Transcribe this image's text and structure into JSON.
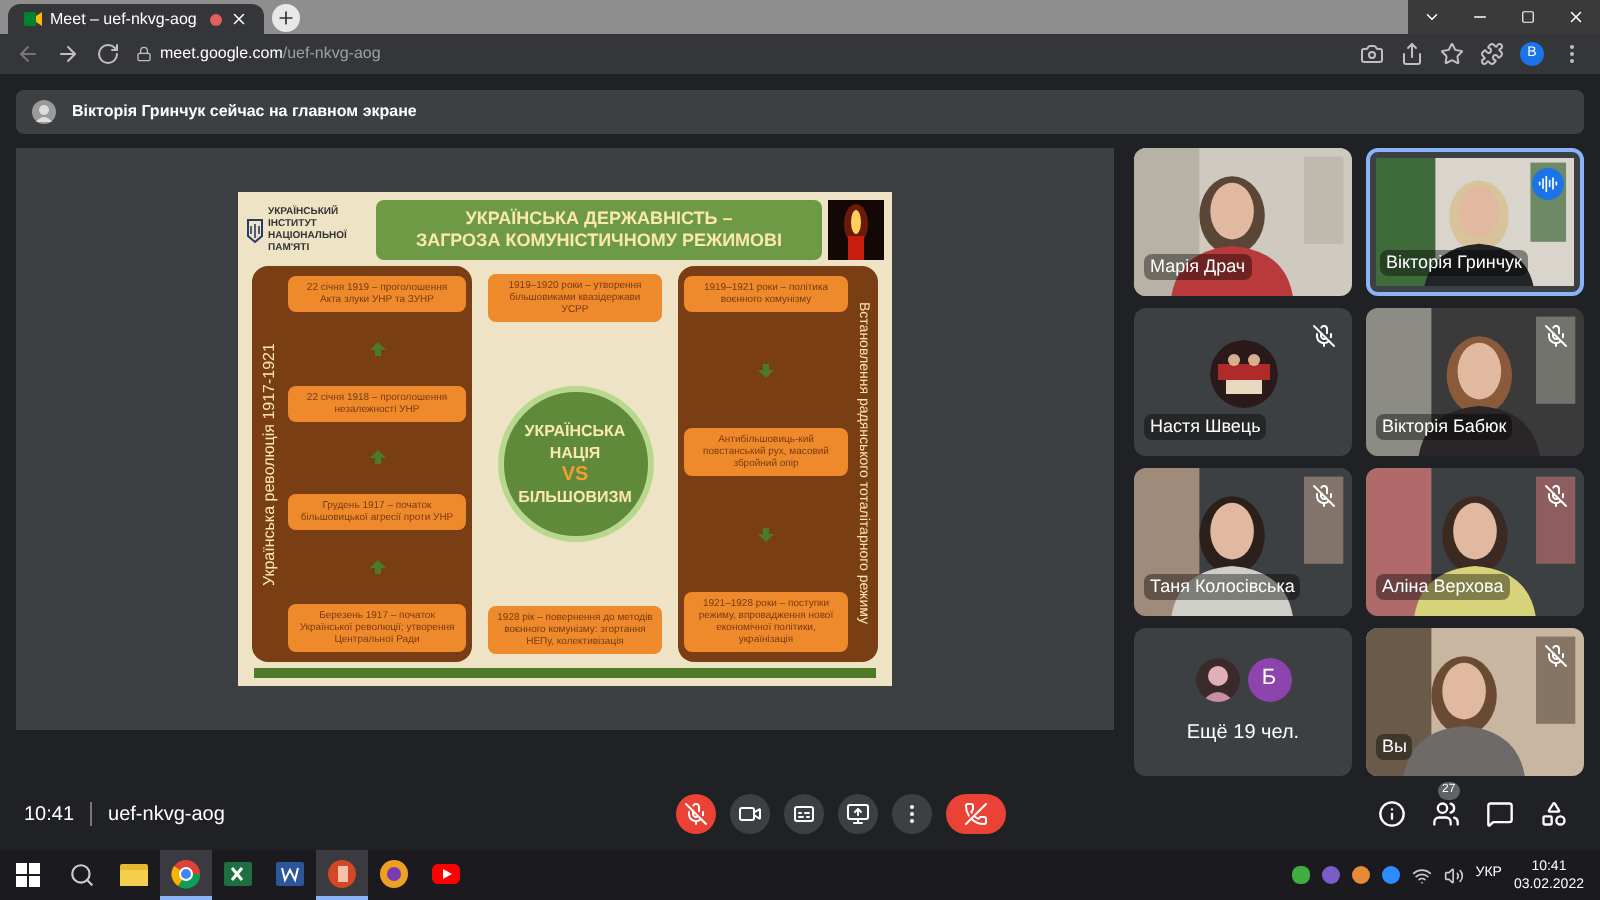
{
  "browser": {
    "tab_title": "Meet – uef-nkvg-aog",
    "url_host": "meet.google.com",
    "url_path": "/uef-nkvg-aog",
    "profile_letter": "В"
  },
  "banner": {
    "text": "Вікторія Гринчук сейчас на главном экране"
  },
  "slide": {
    "institute": "УКРАЇНСЬКИЙ ІНСТИТУТ НАЦІОНАЛЬНОЇ ПАМ'ЯТІ",
    "title_lines": [
      "УКРАЇНСЬКА ДЕРЖАВНІСТЬ –",
      "ЗАГРОЗА КОМУНІСТИЧНОМУ РЕЖИМОВІ"
    ],
    "left_label": "Українська революція 1917-1921",
    "left_boxes": [
      "22 січня 1919 – проголошення Акта злуки УНР та ЗУНР",
      "22 січня 1918 – проголошення незалежності УНР",
      "Грудень 1917 – початок більшовицької агресії проти УНР",
      "Березень 1917 – початок Української революції; утворення Центральної Ради"
    ],
    "top_box": "1919–1920 роки – утворення більшовиками квазідержави УСРР",
    "circle_lines": [
      "УКРАЇНСЬКА",
      "НАЦІЯ",
      "VS",
      "БІЛЬШОВИЗМ"
    ],
    "bottom_box": "1928 рік – повернення до методів воєнного комунізму: згортання НЕПу, колективізація",
    "right_label": "Встановлення радянського тоталітарного режиму",
    "right_boxes": [
      "1919–1921 роки – політика воєнного комунізму",
      "Антибільшовиць-кий повстанський рух, масовий збройний опір",
      "1921–1928 роки – поступки режиму, впровадження нової економічної політики, українізація"
    ]
  },
  "participants": [
    {
      "kind": "video",
      "name": "Марія Драч",
      "muted": false,
      "speaking": false
    },
    {
      "kind": "video",
      "name": "Вікторія Гринчук",
      "muted": false,
      "speaking": true
    },
    {
      "kind": "avatar",
      "name": "Настя Швець",
      "muted": true,
      "speaking": false
    },
    {
      "kind": "video",
      "name": "Вікторія Бабюк",
      "muted": true,
      "speaking": false
    },
    {
      "kind": "video",
      "name": "Таня Колосівська",
      "muted": true,
      "speaking": false
    },
    {
      "kind": "video",
      "name": "Аліна Верхова",
      "muted": true,
      "speaking": false
    },
    {
      "kind": "more",
      "name": "Ещё 19 чел.",
      "letter": "Б",
      "muted": false,
      "speaking": false
    },
    {
      "kind": "video",
      "name": "Вы",
      "muted": true,
      "speaking": false
    }
  ],
  "bottom_bar": {
    "time": "10:41",
    "meeting_code": "uef-nkvg-aog",
    "mic_muted": true,
    "people_count": "27"
  },
  "taskbar": {
    "apps": [
      {
        "kind": "folder",
        "selected": false
      },
      {
        "kind": "browser",
        "selected": true
      },
      {
        "kind": "sheet",
        "selected": false
      },
      {
        "kind": "doc",
        "selected": false
      },
      {
        "kind": "slides",
        "selected": true
      },
      {
        "kind": "browser2",
        "selected": false
      },
      {
        "kind": "video",
        "selected": false
      }
    ],
    "language": "УКР",
    "time": "10:41",
    "date": "03.02.2022"
  }
}
